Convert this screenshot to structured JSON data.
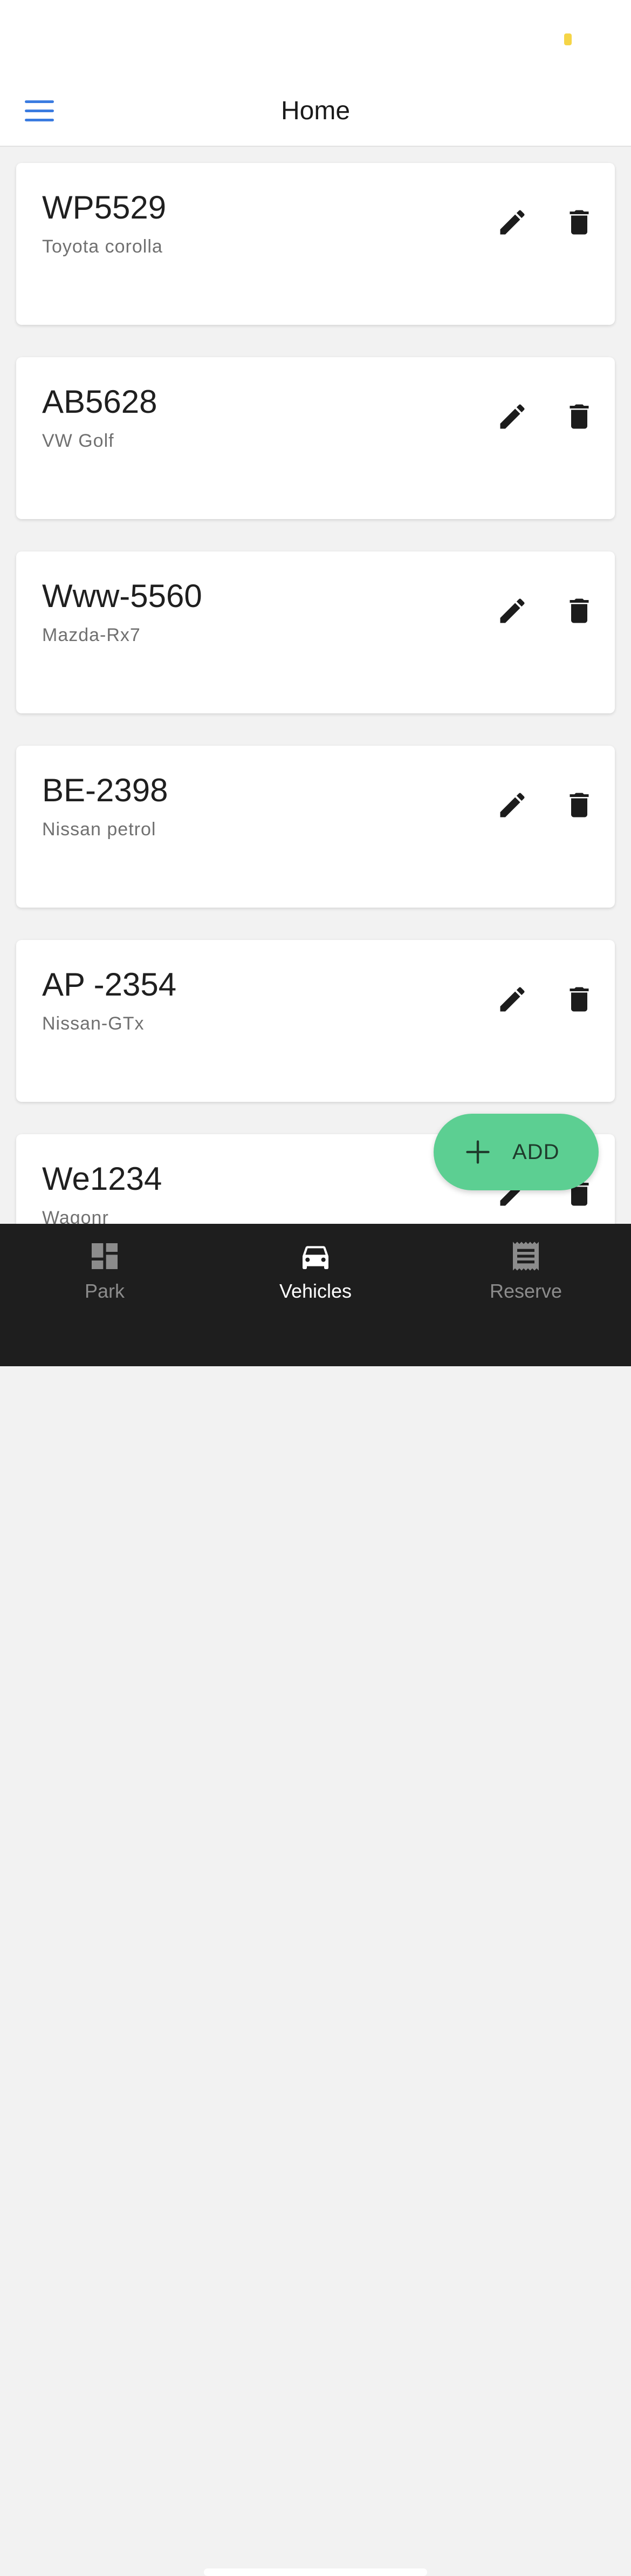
{
  "colors": {
    "accent_blue": "#3a7be0",
    "status_dot": "#f5d547",
    "fab_green": "#5ccf92",
    "tabbar_bg": "#1e1e1e",
    "tab_active": "#ffffff",
    "tab_inactive": "#8c8c8c",
    "icon_dark": "#1c1c1c"
  },
  "header": {
    "title": "Home",
    "menu_icon": "hamburger-menu-icon"
  },
  "vehicles": [
    {
      "plate": "WP5529",
      "model": "Toyota corolla"
    },
    {
      "plate": "AB5628",
      "model": "VW Golf"
    },
    {
      "plate": "Www-5560",
      "model": "Mazda-Rx7"
    },
    {
      "plate": "BE-2398",
      "model": "Nissan petrol"
    },
    {
      "plate": "AP -2354",
      "model": "Nissan-GTx"
    },
    {
      "plate": "We1234",
      "model": "Wagonr"
    }
  ],
  "card_actions": {
    "edit_icon": "pencil-icon",
    "delete_icon": "trash-icon"
  },
  "fab": {
    "label": "ADD",
    "icon": "plus-icon"
  },
  "tabbar": {
    "tabs": [
      {
        "label": "Park",
        "icon": "dashboard-icon",
        "active": false
      },
      {
        "label": "Vehicles",
        "icon": "car-icon",
        "active": true
      },
      {
        "label": "Reserve",
        "icon": "receipt-icon",
        "active": false
      }
    ]
  }
}
